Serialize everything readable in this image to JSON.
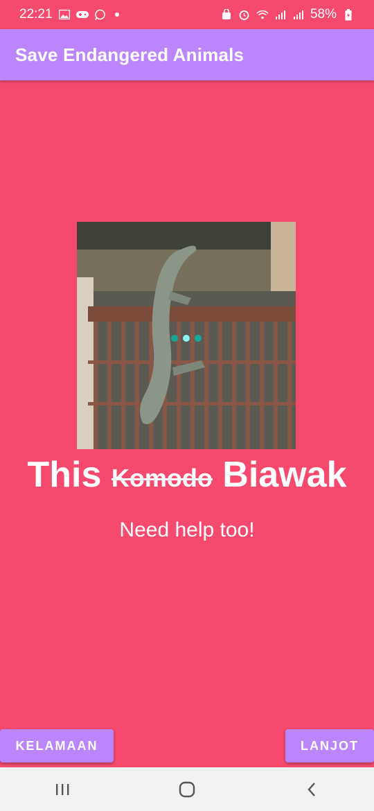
{
  "status_bar": {
    "time": "22:21",
    "battery": "58%",
    "icons_left": [
      "gallery-icon",
      "gamepad-icon",
      "whatsapp-icon",
      "notification-dot"
    ],
    "icons_right": [
      "vpn-icon",
      "alarm-icon",
      "wifi-icon",
      "signal-icon",
      "signal-icon",
      "battery-icon"
    ]
  },
  "app_bar": {
    "title": "Save Endangered Animals"
  },
  "main": {
    "image_alt": "monitor lizard climbing a fence",
    "headline_before": "This",
    "headline_strike": "Komodo",
    "headline_after": "Biawak",
    "subtitle": "Need help too!"
  },
  "buttons": {
    "back": "KELAMAAN",
    "next": "LANJOT"
  },
  "nav": [
    "recent-apps-icon",
    "home-icon",
    "back-icon"
  ],
  "colors": {
    "background": "#f54a6e",
    "accent": "#bb86fc",
    "loader": "#17a79a"
  }
}
